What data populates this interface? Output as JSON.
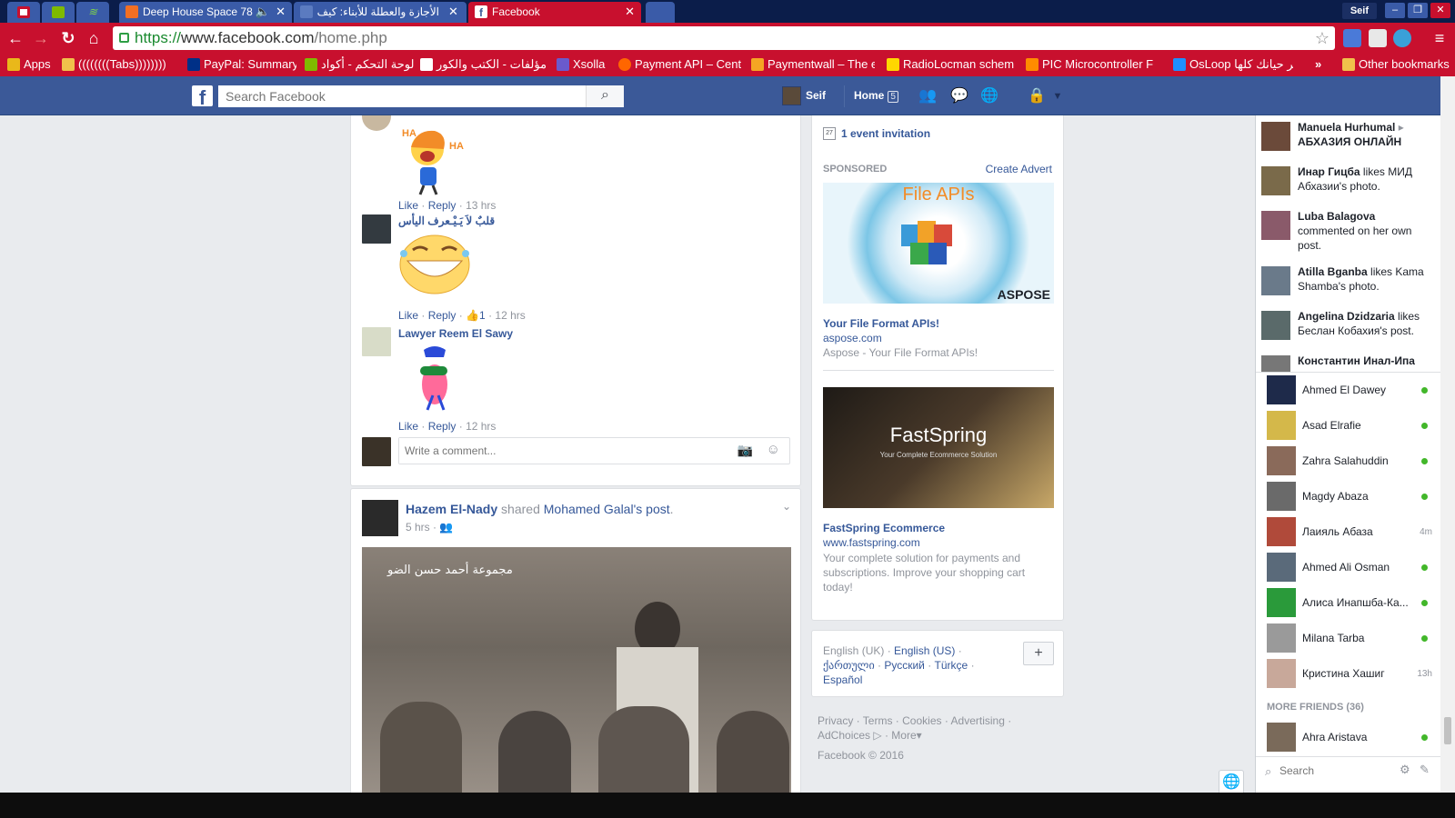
{
  "browser": {
    "tabs": [
      {
        "title": "Deep House Space 78",
        "favicon_color": "#f26f23"
      },
      {
        "title": "الأجازة والعطلة للأبناء: كيف",
        "favicon_color": "#3b5998"
      },
      {
        "title": "Facebook",
        "favicon_color": "#3b5998"
      }
    ],
    "window_user": "Seif",
    "window_buttons": [
      "–",
      "❐",
      "✕"
    ],
    "url_scheme": "https://",
    "url_host": "www.facebook.com",
    "url_path": "/home.php",
    "bookmarks": [
      {
        "label": "Apps",
        "icon_color": "#e9b81a"
      },
      {
        "label": "((((((((Tabs))))))))",
        "icon_color": "#f0c14b"
      },
      {
        "label": "PayPal: Summary",
        "icon_color": "#003087"
      },
      {
        "label": "لوحة التحكم - أكواد",
        "icon_color": "#7fba00"
      },
      {
        "label": "مؤلفات - الكتب والكور",
        "icon_color": "#ffffff"
      },
      {
        "label": "Xsolla",
        "icon_color": "#6a5acd"
      },
      {
        "label": "Payment API – Centi",
        "icon_color": "#ff6600"
      },
      {
        "label": "Paymentwall – The e",
        "icon_color": "#f5a623"
      },
      {
        "label": "RadioLocman schem",
        "icon_color": "#ffd700"
      },
      {
        "label": "PIC Microcontroller F",
        "icon_color": "#ff8c00"
      },
      {
        "label": "OsLoop أخبر حيانك كلها",
        "icon_color": "#1e90ff"
      }
    ],
    "bookmarks_overflow": "»",
    "other_bookmarks": "Other bookmarks"
  },
  "fb_header": {
    "logo": "f",
    "search_placeholder": "Search Facebook",
    "user_name": "Seif",
    "home_label": "Home",
    "home_count": "5"
  },
  "comments": [
    {
      "name": "",
      "text": "",
      "actions": {
        "like": "Like",
        "reply": "Reply",
        "time": "13 hrs"
      },
      "sticker": "HA HA"
    },
    {
      "name": "قلبٌ لاَ يَـيْـعرف اليأس",
      "actions": {
        "like": "Like",
        "reply": "Reply",
        "likes": "1",
        "time": "12 hrs"
      }
    },
    {
      "name": "Lawyer Reem El Sawy",
      "actions": {
        "like": "Like",
        "reply": "Reply",
        "time": "12 hrs"
      }
    }
  ],
  "comment_box": {
    "placeholder": "Write a comment..."
  },
  "post": {
    "author": "Hazem El-Nady",
    "verb": "shared",
    "source": "Mohamed Galal",
    "source_suffix": "'s",
    "object": "post",
    "time": "5 hrs",
    "photo_caption": "مجموعة أحمد حسن الضو"
  },
  "right_column": {
    "event_count": "27",
    "event_text": "1 event invitation",
    "sponsored": "SPONSORED",
    "create_advert": "Create Advert",
    "ads": [
      {
        "title": "Your File Format APIs!",
        "domain": "aspose.com",
        "desc": "Aspose - Your File Format APIs!",
        "image_title": "File APIs",
        "image_brand": "ASPOSE"
      },
      {
        "title": "FastSpring Ecommerce",
        "domain": "www.fastspring.com",
        "desc": "Your complete solution for payments and subscriptions. Improve your shopping cart today!",
        "image_title": "FastSpring",
        "image_sub": "Your Complete Ecommerce Solution"
      }
    ],
    "languages": [
      "English (UK)",
      "English (US)",
      "ქართული",
      "Русский",
      "Türkçe",
      "Español"
    ],
    "lang_add": "+",
    "footer_links": [
      "Privacy",
      "Terms",
      "Cookies",
      "Advertising",
      "AdChoices",
      "More"
    ],
    "copyright": "Facebook © 2016"
  },
  "ticker": [
    {
      "actor": "Manuela Hurhumal",
      "rest": "",
      "target": "АБХАЗИЯ ОНЛАЙН",
      "color": "#6b4a3a"
    },
    {
      "actor": "Инар Гицба",
      "rest": " likes МИД Абхазии's photo.",
      "color": "#7a6a4a"
    },
    {
      "actor": "Luba Balagova",
      "rest": " commented on her own post.",
      "color": "#8a5a6a"
    },
    {
      "actor": "Atilla Bganba",
      "rest": " likes Kama Shamba's photo.",
      "color": "#6a7a8a"
    },
    {
      "actor": "Angelina Dzidzaria",
      "rest": " likes Беслан Кобахия's post.",
      "color": "#5a6a6a"
    },
    {
      "actor": "Константин Инал-Ипа",
      "rest": "",
      "color": "#777777"
    }
  ],
  "chat_friends": [
    {
      "name": "Ahmed El Dawey",
      "status": "online",
      "color": "#1e2a4a"
    },
    {
      "name": "Asad Elrafie",
      "status": "online",
      "color": "#d4b84a"
    },
    {
      "name": "Zahra Salahuddin",
      "status": "online",
      "color": "#8a6a5a"
    },
    {
      "name": "Magdy Abaza",
      "status": "online",
      "color": "#6a6a6a"
    },
    {
      "name": "Лаияль Абаза",
      "status": "4m",
      "color": "#b04a3a"
    },
    {
      "name": "Ahmed Ali Osman",
      "status": "online",
      "color": "#5a6a7a"
    },
    {
      "name": "Алиса Инапшба-Ка...",
      "status": "online",
      "color": "#2a9a3a"
    },
    {
      "name": "Milana Tarba",
      "status": "online",
      "color": "#9a9a9a"
    },
    {
      "name": "Кристина Хашиг",
      "status": "13h",
      "color": "#c8a89a"
    }
  ],
  "more_friends": "MORE FRIENDS (36)",
  "more_friends_list": [
    {
      "name": "Ahra Aristava",
      "status": "online",
      "color": "#7a6a5a"
    }
  ],
  "chat_search_placeholder": "Search"
}
